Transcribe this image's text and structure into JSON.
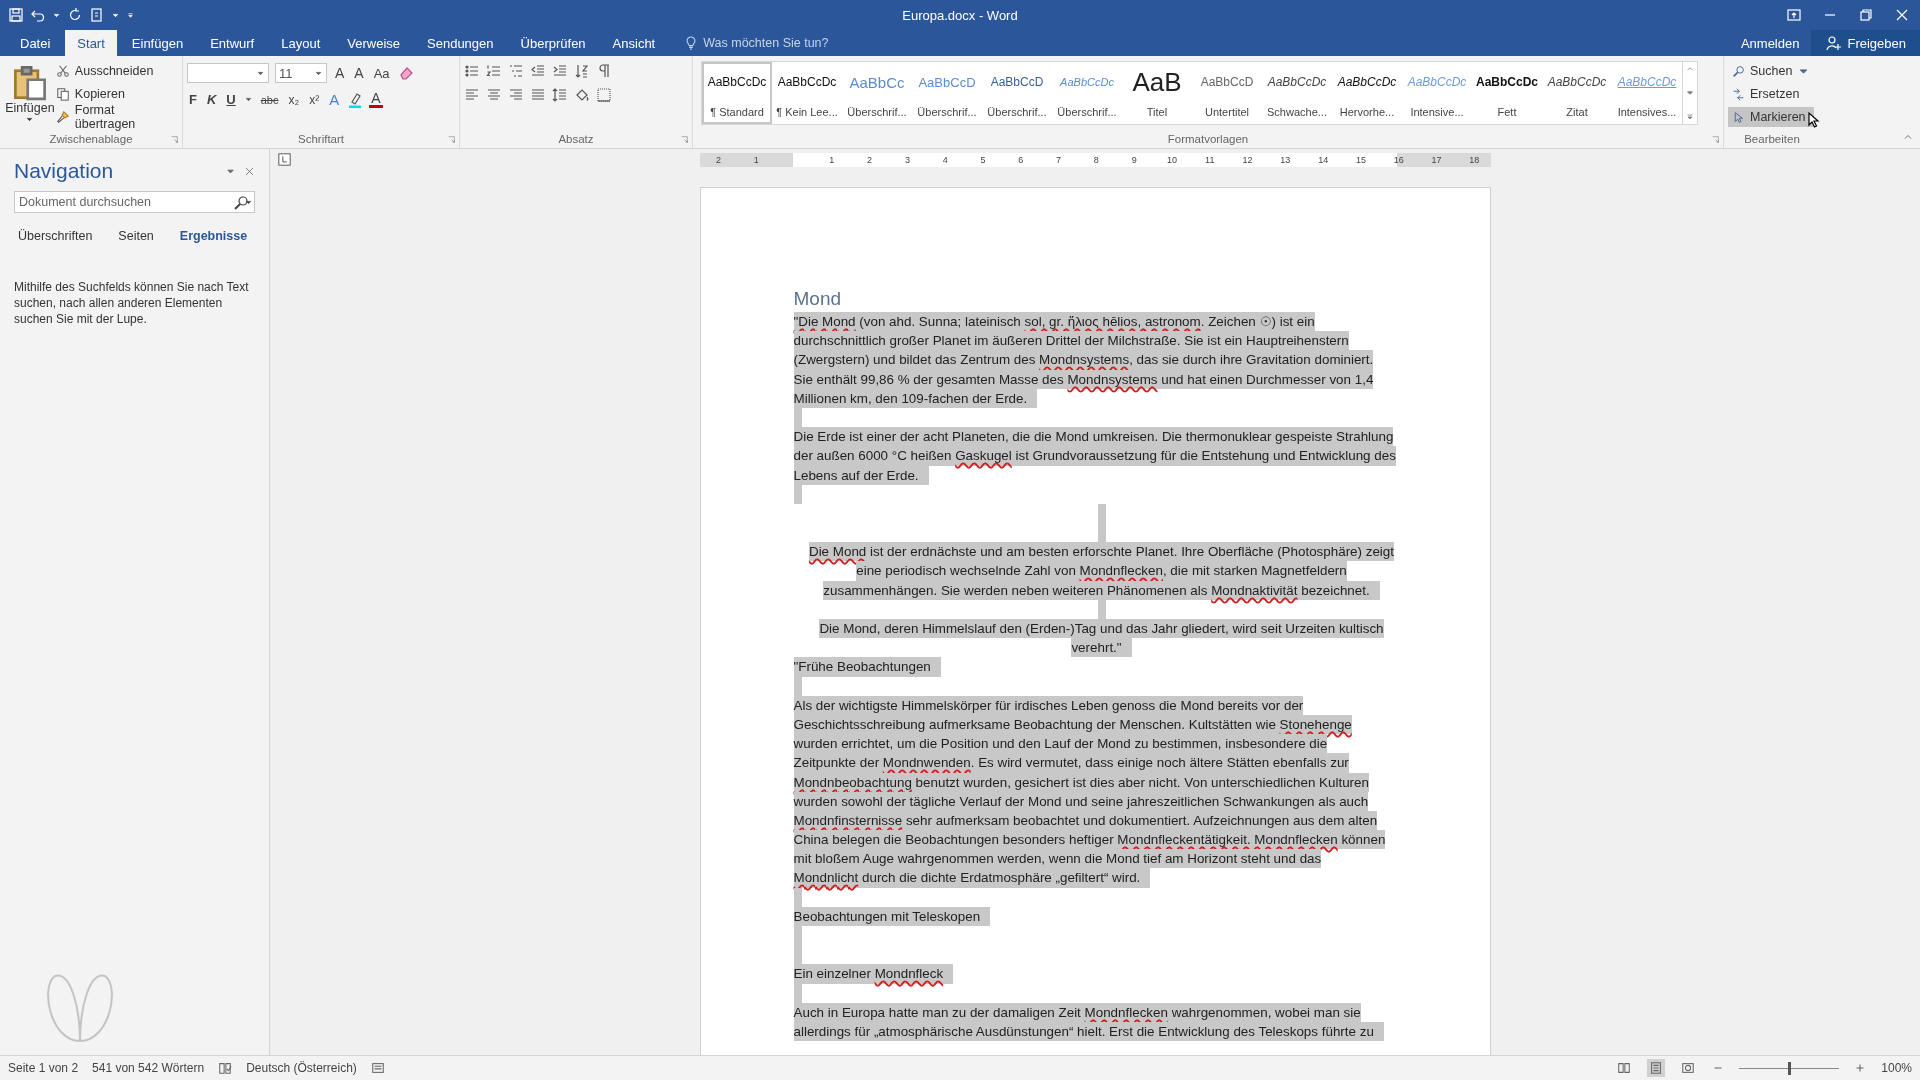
{
  "window": {
    "title": "Europa.docx - Word"
  },
  "ribbon_tabs": [
    {
      "label": "Datei",
      "selected": false
    },
    {
      "label": "Start",
      "selected": true
    },
    {
      "label": "Einfügen",
      "selected": false
    },
    {
      "label": "Entwurf",
      "selected": false
    },
    {
      "label": "Layout",
      "selected": false
    },
    {
      "label": "Verweise",
      "selected": false
    },
    {
      "label": "Sendungen",
      "selected": false
    },
    {
      "label": "Überprüfen",
      "selected": false
    },
    {
      "label": "Ansicht",
      "selected": false
    }
  ],
  "tell_me": {
    "placeholder": "Was möchten Sie tun?"
  },
  "account": {
    "sign_in": "Anmelden",
    "share": "Freigeben"
  },
  "clipboard": {
    "label": "Zwischenablage",
    "paste": "Einfügen",
    "actions": [
      {
        "kind": "cut",
        "label": "Ausschneiden"
      },
      {
        "kind": "copy",
        "label": "Kopieren"
      },
      {
        "kind": "painter",
        "label": "Format übertragen"
      }
    ]
  },
  "font": {
    "label": "Schriftart",
    "font_size": "11",
    "size_buttons": [
      {
        "kind": "grow",
        "label": "A"
      },
      {
        "kind": "shrink",
        "label": "A"
      },
      {
        "kind": "case",
        "label": "Aa"
      }
    ],
    "format_buttons": [
      {
        "kind": "bold",
        "label": "F"
      },
      {
        "kind": "italic",
        "label": "K"
      },
      {
        "kind": "underline",
        "label": "U"
      },
      {
        "kind": "strike",
        "label": "abc"
      },
      {
        "kind": "sub",
        "label": "x₂"
      },
      {
        "kind": "sup",
        "label": "x²"
      }
    ],
    "effects": {
      "label": "A"
    },
    "font_color": {
      "label": "A",
      "color": "#c00000"
    }
  },
  "paragraph": {
    "label": "Absatz"
  },
  "styles": {
    "label": "Formatvorlagen",
    "items": [
      {
        "kind": "normal",
        "preview": "AaBbCcDc",
        "name": "¶ Standard",
        "selected": true
      },
      {
        "kind": "normal",
        "preview": "AaBbCcDc",
        "name": "¶ Kein Lee...",
        "selected": false
      },
      {
        "kind": "heading1",
        "preview": "AaBbCc",
        "name": "Überschrif...",
        "selected": false
      },
      {
        "kind": "heading2",
        "preview": "AaBbCcD",
        "name": "Überschrif...",
        "selected": false
      },
      {
        "kind": "heading3",
        "preview": "AaBbCcD",
        "name": "Überschrif...",
        "selected": false
      },
      {
        "kind": "heading4",
        "preview": "AaBbCcDc",
        "name": "Überschrif...",
        "selected": false
      },
      {
        "kind": "title",
        "preview": "AaB",
        "name": "Titel",
        "selected": false
      },
      {
        "kind": "subtitle",
        "preview": "AaBbCcD",
        "name": "Untertitel",
        "selected": false
      },
      {
        "kind": "subtle",
        "preview": "AaBbCcDc",
        "name": "Schwache...",
        "selected": false
      },
      {
        "kind": "emphasis",
        "preview": "AaBbCcDc",
        "name": "Hervorhe...",
        "selected": false
      },
      {
        "kind": "intense",
        "preview": "AaBbCcDc",
        "name": "Intensive...",
        "selected": false
      },
      {
        "kind": "strong",
        "preview": "AaBbCcDc",
        "name": "Fett",
        "selected": false
      },
      {
        "kind": "quote",
        "preview": "AaBbCcDc",
        "name": "Zitat",
        "selected": false
      },
      {
        "kind": "intensequote",
        "preview": "AaBbCcDc",
        "name": "Intensives...",
        "selected": false
      }
    ]
  },
  "editing": {
    "label": "Bearbeiten",
    "items": [
      {
        "kind": "find",
        "label": "Suchen",
        "highlighted": false
      },
      {
        "kind": "replace",
        "label": "Ersetzen",
        "highlighted": false
      },
      {
        "kind": "select",
        "label": "Markieren",
        "highlighted": true
      }
    ]
  },
  "navigation": {
    "title": "Navigation",
    "search": {
      "placeholder": "Dokument durchsuchen"
    },
    "tabs": [
      {
        "label": "Überschriften",
        "selected": false
      },
      {
        "label": "Seiten",
        "selected": false
      },
      {
        "label": "Ergebnisse",
        "selected": true
      }
    ],
    "message": "Mithilfe des Suchfelds können Sie nach Text suchen, nach allen anderen Elementen suchen Sie mit der Lupe."
  },
  "ruler": {
    "left_labels": [
      "2",
      "1"
    ],
    "labels": [
      "1",
      "2",
      "3",
      "4",
      "5",
      "6",
      "7",
      "8",
      "9",
      "10",
      "11",
      "12",
      "13",
      "14",
      "15",
      "16",
      "17",
      "18"
    ]
  },
  "document": {
    "paragraphs": [
      {
        "kind": "heading",
        "centered": false,
        "selected": false,
        "lines": [
          [
            {
              "text": "Mond",
              "misspelled": false
            }
          ]
        ]
      },
      {
        "kind": "body",
        "centered": false,
        "selected": true,
        "lines": [
          [
            {
              "text": "\"Die Mond",
              "misspelled": true
            },
            {
              "text": " (von ahd. Sunna; lateinisch ",
              "misspelled": false
            },
            {
              "text": "sol, gr. ἥλιος hēlios, astronom",
              "misspelled": true
            },
            {
              "text": ". Zeichen ☉) ist ein",
              "misspelled": false
            }
          ],
          [
            {
              "text": "durchschnittlich großer Planet im äußeren Drittel der Milchstraße. Sie ist ein Hauptreihenstern",
              "misspelled": false
            }
          ],
          [
            {
              "text": "(Zwergstern) und bildet das Zentrum des ",
              "misspelled": false
            },
            {
              "text": "Mondnsystems",
              "misspelled": true
            },
            {
              "text": ", das sie durch ihre Gravitation dominiert.",
              "misspelled": false
            }
          ],
          [
            {
              "text": "Sie enthält 99,86 % der gesamten Masse des ",
              "misspelled": false
            },
            {
              "text": "Mondnsystems",
              "misspelled": true
            },
            {
              "text": " und hat einen Durchmesser von 1,4",
              "misspelled": false
            }
          ],
          [
            {
              "text": "Millionen km, den 109-fachen der Erde.",
              "misspelled": false
            }
          ]
        ]
      },
      {
        "kind": "empty",
        "centered": false,
        "selected": true
      },
      {
        "kind": "body",
        "centered": false,
        "selected": true,
        "lines": [
          [
            {
              "text": "Die Erde ist einer der acht Planeten, die die Mond umkreisen. Die thermonuklear gespeiste Strahlung",
              "misspelled": false
            }
          ],
          [
            {
              "text": "der außen 6000 °C heißen ",
              "misspelled": false
            },
            {
              "text": "Gaskugel",
              "misspelled": true
            },
            {
              "text": " ist Grundvoraussetzung für die Entstehung und Entwicklung des",
              "misspelled": false
            }
          ],
          [
            {
              "text": "Lebens auf der Erde.",
              "misspelled": false
            }
          ]
        ]
      },
      {
        "kind": "empty",
        "centered": false,
        "selected": true
      },
      {
        "kind": "empty",
        "centered": true,
        "selected": true
      },
      {
        "kind": "empty",
        "centered": true,
        "selected": true
      },
      {
        "kind": "body",
        "centered": true,
        "selected": true,
        "lines": [
          [
            {
              "text": "Die Mond",
              "misspelled": true
            },
            {
              "text": " ist der erdnächste und am besten erforschte Planet. Ihre Oberfläche (Photosphäre) zeigt",
              "misspelled": false
            }
          ],
          [
            {
              "text": "eine periodisch wechselnde Zahl von ",
              "misspelled": false
            },
            {
              "text": "Mondnflecken",
              "misspelled": true
            },
            {
              "text": ", die mit starken Magnetfeldern",
              "misspelled": false
            }
          ],
          [
            {
              "text": "zusammenhängen. Sie werden neben weiteren Phänomenen als ",
              "misspelled": false
            },
            {
              "text": "Mondnaktivität",
              "misspelled": true
            },
            {
              "text": " bezeichnet.",
              "misspelled": false
            }
          ]
        ]
      },
      {
        "kind": "empty",
        "centered": true,
        "selected": true
      },
      {
        "kind": "body",
        "centered": true,
        "selected": true,
        "lines": [
          [
            {
              "text": "Die Mond, deren Himmelslauf den (Erden-)Tag und das Jahr gliedert, wird seit Urzeiten kultisch",
              "misspelled": false
            }
          ],
          [
            {
              "text": "verehrt.\"",
              "misspelled": false
            }
          ]
        ]
      },
      {
        "kind": "body",
        "centered": false,
        "selected": true,
        "lines": [
          [
            {
              "text": "\"Frühe Beobachtungen",
              "misspelled": false
            }
          ]
        ]
      },
      {
        "kind": "empty",
        "centered": false,
        "selected": true
      },
      {
        "kind": "body",
        "centered": false,
        "selected": true,
        "lines": [
          [
            {
              "text": "Als der wichtigste Himmelskörper für irdisches Leben genoss die Mond bereits vor der",
              "misspelled": false
            }
          ],
          [
            {
              "text": "Geschichtsschreibung aufmerksame Beobachtung der Menschen. Kultstätten wie ",
              "misspelled": false
            },
            {
              "text": "Stonehenge",
              "misspelled": true
            }
          ],
          [
            {
              "text": "wurden errichtet, um die Position und den Lauf der Mond zu bestimmen, insbesondere die",
              "misspelled": false
            }
          ],
          [
            {
              "text": "Zeitpunkte der ",
              "misspelled": false
            },
            {
              "text": "Mondnwenden",
              "misspelled": true
            },
            {
              "text": ". Es wird vermutet, dass einige noch ältere Stätten ebenfalls zur",
              "misspelled": false
            }
          ],
          [
            {
              "text": "Mondnbeobachtung",
              "misspelled": true
            },
            {
              "text": " benutzt wurden, gesichert ist dies aber nicht. Von unterschiedlichen Kulturen",
              "misspelled": false
            }
          ],
          [
            {
              "text": "wurden sowohl der tägliche Verlauf der Mond und seine jahreszeitlichen Schwankungen als auch",
              "misspelled": false
            }
          ],
          [
            {
              "text": "Mondnfinsternisse",
              "misspelled": true
            },
            {
              "text": " sehr aufmerksam beobachtet und dokumentiert. Aufzeichnungen aus dem alten",
              "misspelled": false
            }
          ],
          [
            {
              "text": "China belegen die Beobachtungen besonders heftiger ",
              "misspelled": false
            },
            {
              "text": "Mondnfleckentätigkeit. Mondnflecken",
              "misspelled": true
            },
            {
              "text": " können",
              "misspelled": false
            }
          ],
          [
            {
              "text": "mit bloßem Auge wahrgenommen werden, wenn die Mond tief am Horizont steht und das",
              "misspelled": false
            }
          ],
          [
            {
              "text": "Mondnlicht",
              "misspelled": true
            },
            {
              "text": " durch die dichte Erdatmosphäre „gefiltert“ wird.",
              "misspelled": false
            }
          ]
        ]
      },
      {
        "kind": "empty",
        "centered": false,
        "selected": true
      },
      {
        "kind": "body",
        "centered": false,
        "selected": true,
        "lines": [
          [
            {
              "text": "Beobachtungen mit Teleskopen",
              "misspelled": false
            }
          ]
        ]
      },
      {
        "kind": "empty",
        "centered": false,
        "selected": true
      },
      {
        "kind": "empty",
        "centered": false,
        "selected": true
      },
      {
        "kind": "body",
        "centered": false,
        "selected": true,
        "lines": [
          [
            {
              "text": "Ein einzelner ",
              "misspelled": false
            },
            {
              "text": "Mondnfleck",
              "misspelled": true
            }
          ]
        ]
      },
      {
        "kind": "empty",
        "centered": false,
        "selected": true
      },
      {
        "kind": "body",
        "centered": false,
        "selected": true,
        "lines": [
          [
            {
              "text": "Auch in Europa hatte man zu der damaligen Zeit ",
              "misspelled": false
            },
            {
              "text": "Mondnflecken",
              "misspelled": true
            },
            {
              "text": " wahrgenommen, wobei man sie",
              "misspelled": false
            }
          ],
          [
            {
              "text": "allerdings für „atmosphärische Ausdünstungen“ hielt. Erst die Entwicklung des Teleskops führte zu",
              "misspelled": false
            }
          ]
        ]
      }
    ]
  },
  "status_bar": {
    "page": "Seite 1 von 2",
    "words": "541 von 542 Wörtern",
    "language": "Deutsch (Österreich)",
    "views": [
      {
        "kind": "read",
        "selected": false
      },
      {
        "kind": "print",
        "selected": true
      },
      {
        "kind": "web",
        "selected": false
      }
    ],
    "zoom": {
      "level": 0.5,
      "reading": "100%"
    }
  }
}
